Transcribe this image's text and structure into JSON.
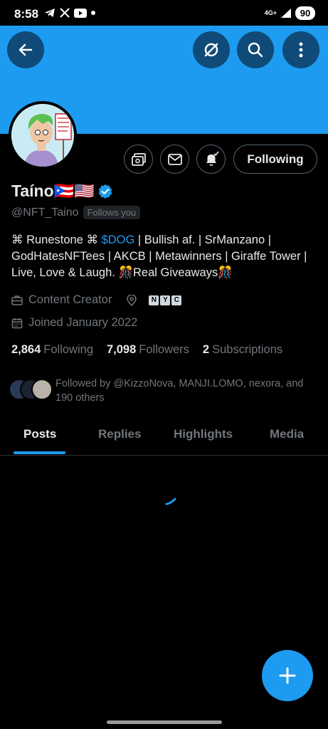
{
  "status_bar": {
    "time": "8:58",
    "network": "4G+",
    "battery": "90",
    "icons": [
      "telegram-icon",
      "x-icon",
      "youtube-icon",
      "dot-icon",
      "signal-icon"
    ]
  },
  "profile": {
    "display_name": "Taíno🇵🇷🇺🇸",
    "handle": "@NFT_Taino",
    "follows_you": "Follows you",
    "following_button": "Following",
    "bio_prefix": "⌘ Runestone ⌘ ",
    "bio_highlight": "$DOG",
    "bio_rest": " | Bullish af. | SrManzano | GodHatesNFTees | AKCB | Metawinners | Giraffe Tower | Live, Love & Laugh. 🎊Real Giveaways🎊",
    "category": "Content Creator",
    "location_letters": [
      "N",
      "Y",
      "C"
    ],
    "joined": "Joined January 2022",
    "stats": {
      "following_count": "2,864",
      "following_label": "Following",
      "followers_count": "7,098",
      "followers_label": "Followers",
      "subscriptions_count": "2",
      "subscriptions_label": "Subscriptions"
    },
    "followed_by": "Followed by @KizzoNova, MANJI.LOMO, nexora, and 190 others"
  },
  "tabs": [
    {
      "label": "Posts",
      "active": true
    },
    {
      "label": "Replies",
      "active": false
    },
    {
      "label": "Highlights",
      "active": false
    },
    {
      "label": "Media",
      "active": false
    }
  ],
  "colors": {
    "accent": "#1d9bf0",
    "background": "#000000",
    "muted_text": "#71767b"
  }
}
